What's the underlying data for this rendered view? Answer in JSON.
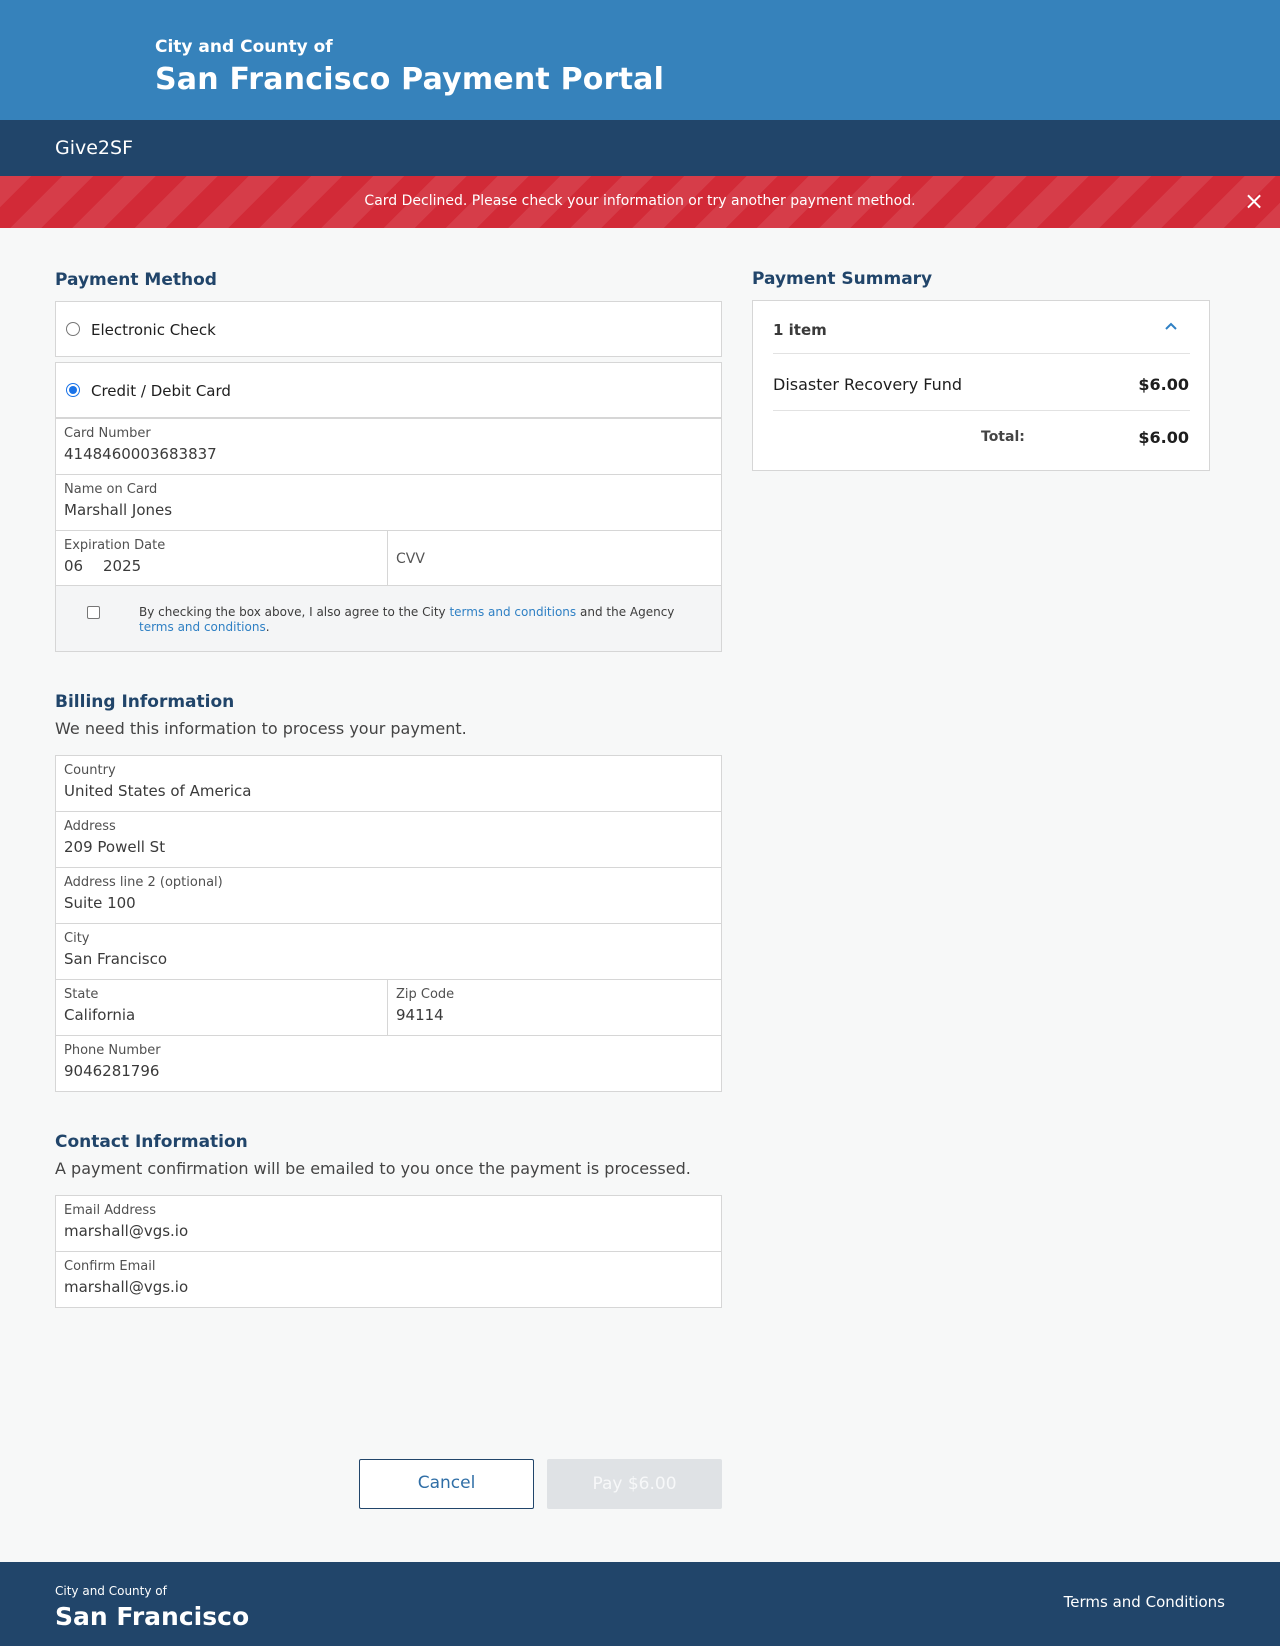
{
  "header": {
    "subtitle": "City and County of",
    "title": "San Francisco Payment Portal"
  },
  "nav": {
    "brand": "Give2SF"
  },
  "alert": {
    "message": "Card Declined. Please check your information or try another payment method.",
    "close_icon": "×"
  },
  "payment_method": {
    "title": "Payment Method",
    "options": [
      {
        "label": "Electronic Check",
        "selected": false
      },
      {
        "label": "Credit / Debit Card",
        "selected": true
      }
    ],
    "card_number": {
      "label": "Card Number",
      "value": "4148460003683837"
    },
    "name_on_card": {
      "label": "Name on Card",
      "value": "Marshall Jones"
    },
    "expiration": {
      "label": "Expiration Date",
      "month": "06",
      "year": "2025"
    },
    "cvv": {
      "placeholder": "CVV"
    },
    "terms": {
      "prefix": "By checking the box above, I also agree to the City ",
      "city_link": "terms and conditions",
      "middle": " and the Agency ",
      "agency_link": "terms and conditions",
      "suffix": "."
    }
  },
  "billing": {
    "title": "Billing Information",
    "description": "We need this information to process your payment.",
    "country": {
      "label": "Country",
      "value": "United States of America"
    },
    "address": {
      "label": "Address",
      "value": "209 Powell St"
    },
    "address2": {
      "label": "Address line 2 (optional)",
      "value": "Suite 100"
    },
    "city": {
      "label": "City",
      "value": "San Francisco"
    },
    "state": {
      "label": "State",
      "value": "California"
    },
    "zip": {
      "label": "Zip Code",
      "value": "94114"
    },
    "phone": {
      "label": "Phone Number",
      "value": "9046281796"
    }
  },
  "contact": {
    "title": "Contact Information",
    "description": "A payment confirmation will be emailed to you once the payment is processed.",
    "email": {
      "label": "Email Address",
      "value": "marshall@vgs.io"
    },
    "confirm_email": {
      "label": "Confirm Email",
      "value": "marshall@vgs.io"
    }
  },
  "summary": {
    "title": "Payment Summary",
    "item_count": "1 item",
    "chevron_icon": "chevron-up-icon",
    "items": [
      {
        "name": "Disaster Recovery Fund",
        "amount": "$6.00"
      }
    ],
    "total_label": "Total:",
    "total_amount": "$6.00"
  },
  "actions": {
    "cancel_label": "Cancel",
    "pay_label": "Pay $6.00"
  },
  "footer": {
    "subtitle": "City and County of",
    "title": "San Francisco",
    "terms_link": "Terms and Conditions"
  },
  "colors": {
    "header_blue": "#3682bb",
    "navy": "#21456a",
    "alert_red": "#d22a37",
    "link_blue": "#2f80c4"
  }
}
